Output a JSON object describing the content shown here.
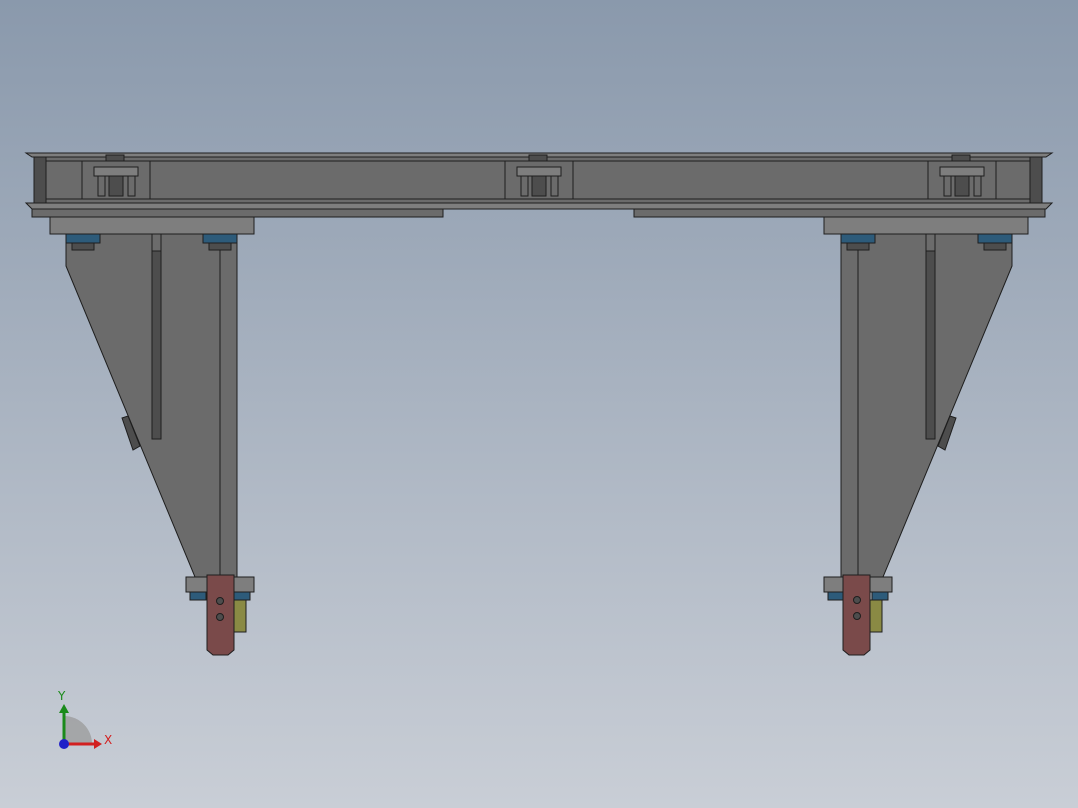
{
  "viewport": {
    "background_top": "#8a99ac",
    "background_bottom": "#c9ced6"
  },
  "colors": {
    "steel": "#6b6b6b",
    "steel_light": "#7e7e7e",
    "steel_dark": "#4d4d4d",
    "outline": "#1e1e1e",
    "nut_blue": "#2d5b7a",
    "bracket_red": "#7a4a4a",
    "pad_olive": "#8a8a44"
  },
  "triad": {
    "x_label": "X",
    "y_label": "Y",
    "x_color": "#d22020",
    "y_color": "#1a8a1a",
    "z_color": "#2020c8"
  }
}
